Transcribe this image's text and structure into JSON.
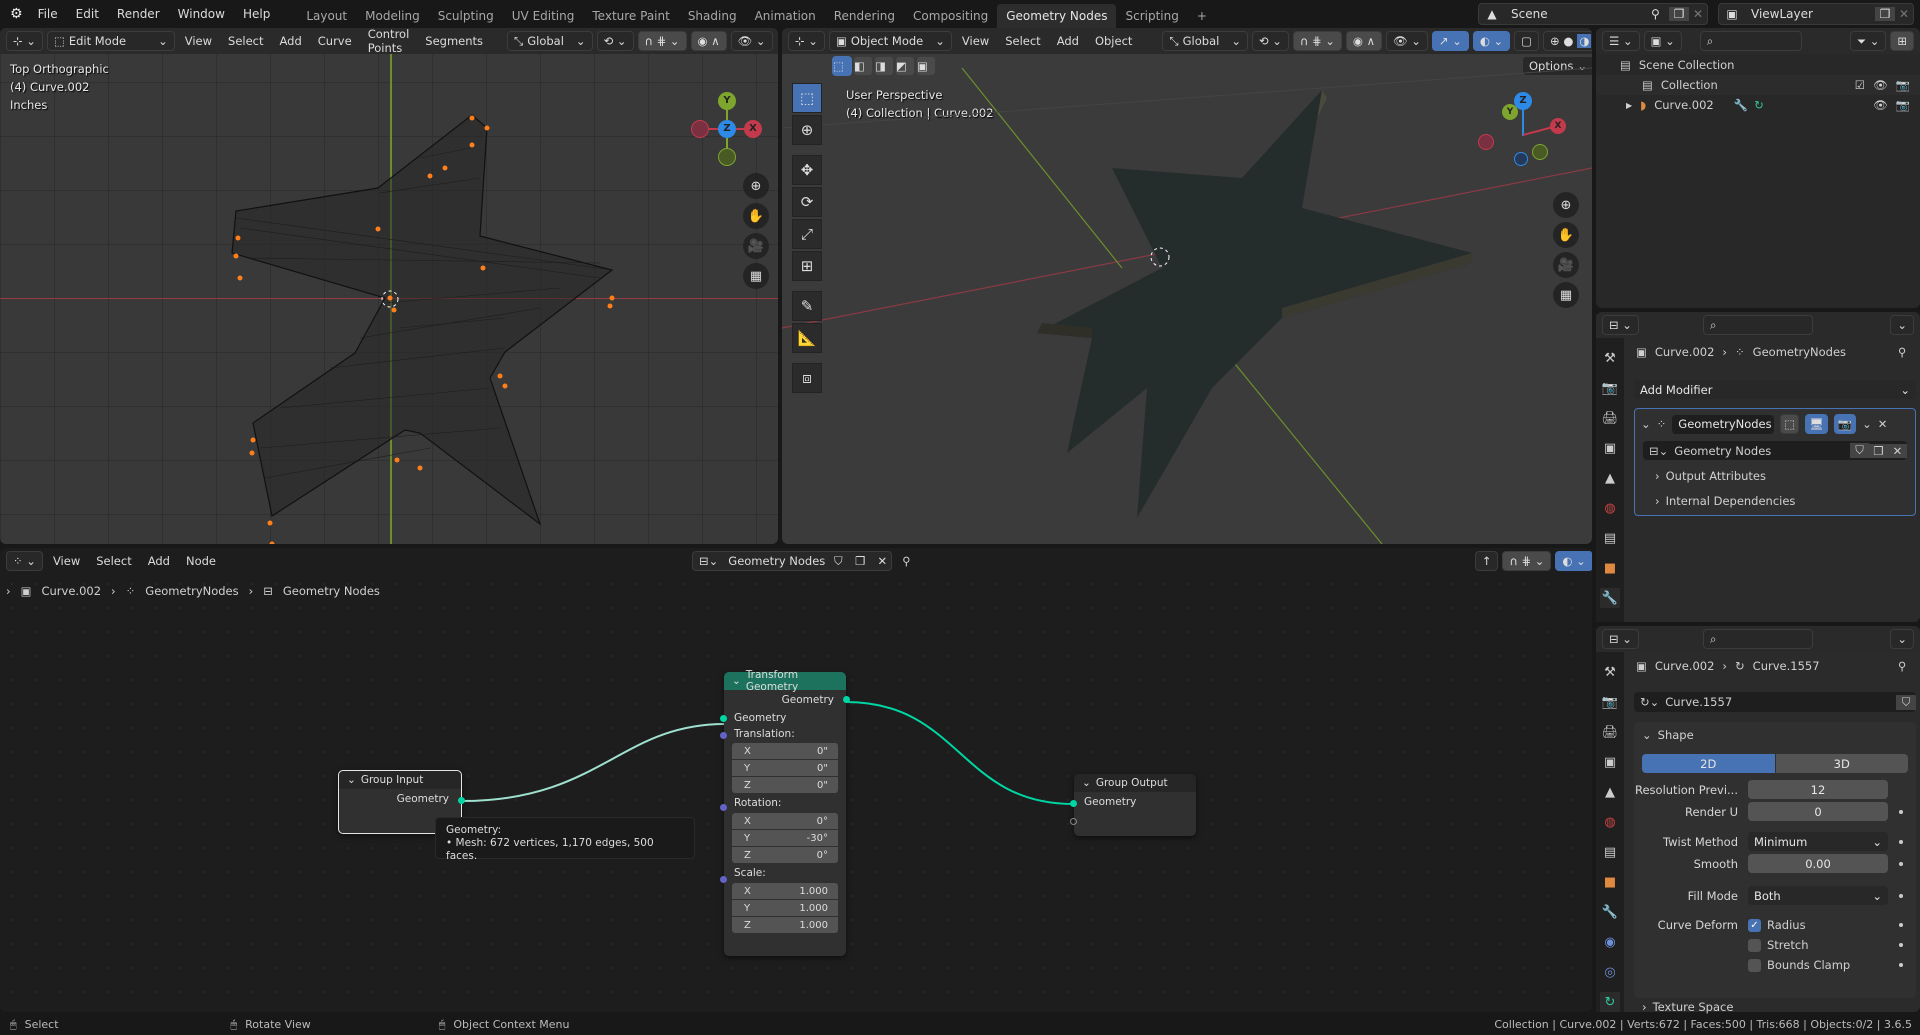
{
  "topbar": {
    "menus": [
      "File",
      "Edit",
      "Render",
      "Window",
      "Help"
    ],
    "workspaces": [
      "Layout",
      "Modeling",
      "Sculpting",
      "UV Editing",
      "Texture Paint",
      "Shading",
      "Animation",
      "Rendering",
      "Compositing",
      "Geometry Nodes",
      "Scripting"
    ],
    "active_workspace": "Geometry Nodes",
    "add_tab": "+",
    "scene": "Scene",
    "view_layer": "ViewLayer"
  },
  "left_viewport": {
    "mode": "Edit Mode",
    "menus": [
      "View",
      "Select",
      "Add",
      "Curve",
      "Control Points",
      "Segments"
    ],
    "orientation": "Global",
    "overlay_lines": [
      "Top Orthographic",
      "(4) Curve.002",
      "Inches"
    ],
    "gizmo_axes": [
      "X",
      "Y",
      "Z"
    ]
  },
  "right_viewport": {
    "mode": "Object Mode",
    "menus": [
      "View",
      "Select",
      "Add",
      "Object"
    ],
    "orientation": "Global",
    "options": "Options",
    "overlay_lines": [
      "User Perspective",
      "(4) Collection | Curve.002"
    ],
    "gizmo_axes": [
      "X",
      "Y",
      "Z"
    ]
  },
  "outliner": {
    "items": [
      {
        "label": "Scene Collection"
      },
      {
        "label": "Collection"
      },
      {
        "label": "Curve.002"
      }
    ]
  },
  "modifier_panel": {
    "breadcrumb": [
      "Curve.002",
      "GeometryNodes"
    ],
    "add_modifier": "Add Modifier",
    "modifier_name": "GeometryNodes",
    "node_group": "Geometry Nodes",
    "subpanels": [
      "Output Attributes",
      "Internal Dependencies"
    ]
  },
  "data_panel": {
    "breadcrumb": [
      "Curve.002",
      "Curve.1557"
    ],
    "datablock": "Curve.1557",
    "shape_title": "Shape",
    "dim_options": [
      "2D",
      "3D"
    ],
    "active_dim": "2D",
    "fields": [
      {
        "label": "Resolution Previ...",
        "value": "12"
      },
      {
        "label": "Render U",
        "value": "0"
      },
      {
        "label": "Twist Method",
        "value": "Minimum"
      },
      {
        "label": "Smooth",
        "value": "0.00"
      },
      {
        "label": "Fill Mode",
        "value": "Both"
      }
    ],
    "curve_deform_label": "Curve Deform",
    "checkboxes": [
      {
        "label": "Radius",
        "checked": true
      },
      {
        "label": "Stretch",
        "checked": false
      },
      {
        "label": "Bounds Clamp",
        "checked": false
      }
    ],
    "texture_space": "Texture Space"
  },
  "node_editor": {
    "menus": [
      "View",
      "Select",
      "Add",
      "Node"
    ],
    "node_group": "Geometry Nodes",
    "breadcrumb": [
      "Curve.002",
      "GeometryNodes",
      "Geometry Nodes"
    ],
    "group_input": {
      "title": "Group Input",
      "output": "Geometry"
    },
    "transform": {
      "title": "Transform Geometry",
      "output": "Geometry",
      "input": "Geometry",
      "translation_label": "Translation:",
      "translation": [
        {
          "axis": "X",
          "value": "0\""
        },
        {
          "axis": "Y",
          "value": "0\""
        },
        {
          "axis": "Z",
          "value": "0\""
        }
      ],
      "rotation_label": "Rotation:",
      "rotation": [
        {
          "axis": "X",
          "value": "0°"
        },
        {
          "axis": "Y",
          "value": "-30°"
        },
        {
          "axis": "Z",
          "value": "0°"
        }
      ],
      "scale_label": "Scale:",
      "scale": [
        {
          "axis": "X",
          "value": "1.000"
        },
        {
          "axis": "Y",
          "value": "1.000"
        },
        {
          "axis": "Z",
          "value": "1.000"
        }
      ]
    },
    "group_output": {
      "title": "Group Output",
      "input": "Geometry"
    },
    "tooltip": {
      "title": "Geometry:",
      "line": "• Mesh: 672 vertices, 1,170 edges, 500 faces."
    }
  },
  "statusbar": {
    "hints": [
      "Select",
      "Rotate View",
      "Object Context Menu"
    ],
    "stats": "Collection | Curve.002 | Verts:672 | Faces:500 | Tris:668 | Objects:0/2 | 3.6.5"
  },
  "colors": {
    "accent": "#4772b3",
    "geometry_socket": "#00d6a3",
    "vector_socket": "#6363c7",
    "node_header_geo": "#1d725e"
  }
}
